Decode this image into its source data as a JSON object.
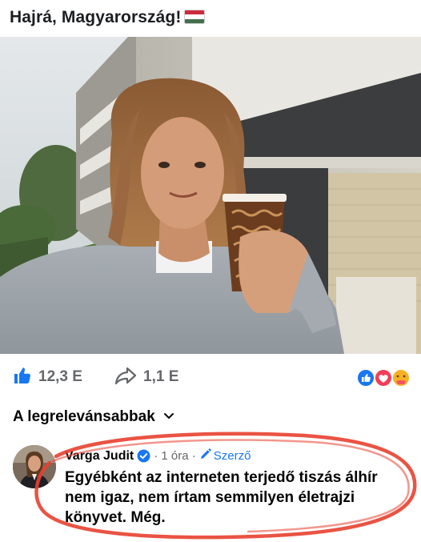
{
  "post": {
    "text": "Hajrá, Magyarország!",
    "flag_colors": [
      "#cd2a3e",
      "#ffffff",
      "#436f4d"
    ]
  },
  "stats": {
    "like_icon": "thumbs-up-icon",
    "like_count": "12,3 E",
    "share_icon": "share-arrow-icon",
    "share_count": "1,1 E",
    "reaction_icons": [
      "like-reaction-icon",
      "love-reaction-icon",
      "care-reaction-icon"
    ]
  },
  "sort": {
    "label": "A legrelevánsabbak",
    "icon": "chevron-down-icon"
  },
  "comment": {
    "author": "Varga Judit",
    "verified_icon": "verified-badge-icon",
    "meta": "· 1 óra ·",
    "role": "Szerző",
    "role_icon": "pencil-icon",
    "text": "Egyébként az interneten terjedő tiszás álhír nem igaz, nem írtam semmilyen életrajzi könyvet. Még."
  },
  "colors": {
    "accent": "#1877f2",
    "annotation": "#e8402f",
    "muted": "#65676b"
  }
}
